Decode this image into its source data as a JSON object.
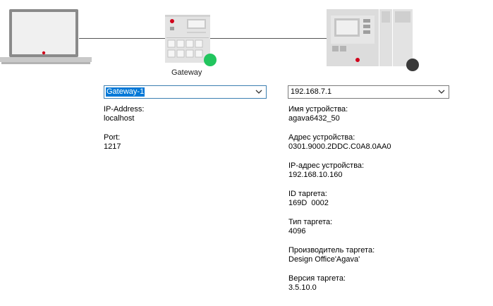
{
  "gateway": {
    "device_label": "Gateway",
    "status_color": "#22c55e",
    "dropdown": {
      "value": "Gateway-1"
    },
    "fields": [
      {
        "label": "IP-Address:",
        "value": "localhost"
      },
      {
        "label": "Port:",
        "value": "1217"
      }
    ]
  },
  "device": {
    "status_color": "#3a3a3a",
    "dropdown": {
      "value": "192.168.7.1"
    },
    "fields": [
      {
        "label": "Имя устройства:",
        "value": "agava6432_50"
      },
      {
        "label": "Адрес устройства:",
        "value": "0301.9000.2DDC.C0A8.0AA0"
      },
      {
        "label": "IP-адрес устройства:",
        "value": "192.168.10.160"
      },
      {
        "label": "ID таргета:",
        "value": "169D  0002"
      },
      {
        "label": "Тип таргета:",
        "value": "4096"
      },
      {
        "label": "Производитель таргета:",
        "value": "Design Office'Agava'"
      },
      {
        "label": "Версия таргета:",
        "value": "3.5.10.0"
      }
    ]
  },
  "icons": {
    "laptop": "laptop-icon",
    "gateway": "gateway-device-icon",
    "plc": "plc-device-icon",
    "chevron": "chevron-down-icon"
  }
}
